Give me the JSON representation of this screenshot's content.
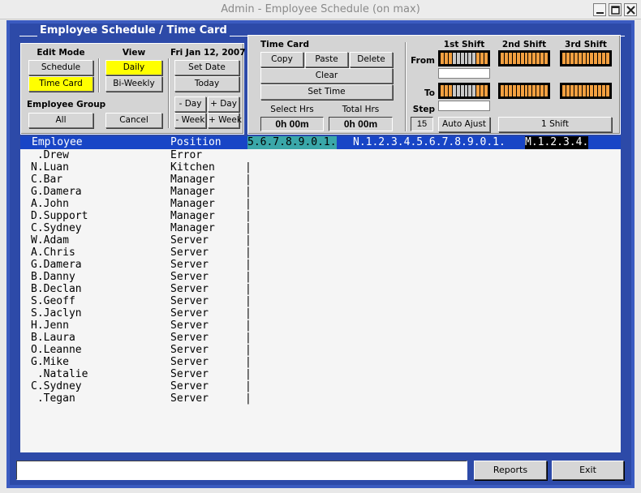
{
  "window": {
    "title": "Admin - Employee Schedule (on max)"
  },
  "group_title": "Employee Schedule / Time Card",
  "edit_mode": {
    "label": "Edit Mode",
    "schedule": "Schedule",
    "time_card": "Time Card"
  },
  "view": {
    "label": "View",
    "daily": "Daily",
    "biweekly": "Bi-Weekly"
  },
  "employee_group": {
    "label": "Employee Group",
    "all": "All",
    "cancel": "Cancel"
  },
  "date": {
    "label": "Fri Jan 12, 2007",
    "set_date": "Set Date",
    "today": "Today",
    "minus_day": "- Day",
    "plus_day": "+ Day",
    "minus_week": "- Week",
    "plus_week": "+ Week"
  },
  "time_card": {
    "label": "Time Card",
    "copy": "Copy",
    "paste": "Paste",
    "delete": "Delete",
    "clear": "Clear",
    "set_time": "Set Time",
    "select_hrs_label": "Select Hrs",
    "select_hrs_value": "0h 00m",
    "total_hrs_label": "Total Hrs",
    "total_hrs_value": "0h 00m"
  },
  "shifts": {
    "first": "1st Shift",
    "second": "2nd Shift",
    "third": "3rd Shift",
    "from": "From",
    "to": "To",
    "step_label": "Step",
    "step_value": "15",
    "auto_adjust": "Auto Ajust",
    "shift_count": "1 Shift"
  },
  "colors": {
    "frame": "#2d4aa8",
    "header": "#1845c6",
    "teal": "#3aa7a9",
    "highlight": "#ffff00",
    "swatch_orange": "#f3a040"
  },
  "header": {
    "employee": "Employee",
    "position": "Position",
    "hours_teal": "5.6.7.8.9.0.1.",
    "hours_blue": "N.1.2.3.4.5.6.7.8.9.0.1.",
    "hours_black": "M.1.2.3.4."
  },
  "employees": [
    {
      "name": " .Drew",
      "position": "Error",
      "mark": ""
    },
    {
      "name": "N.Luan",
      "position": "Kitchen",
      "mark": "|"
    },
    {
      "name": "C.Bar",
      "position": "Manager",
      "mark": "|"
    },
    {
      "name": "G.Damera",
      "position": "Manager",
      "mark": "|"
    },
    {
      "name": "A.John",
      "position": "Manager",
      "mark": "|"
    },
    {
      "name": "D.Support",
      "position": "Manager",
      "mark": "|"
    },
    {
      "name": "C.Sydney",
      "position": "Manager",
      "mark": "|"
    },
    {
      "name": "W.Adam",
      "position": "Server",
      "mark": "|"
    },
    {
      "name": "A.Chris",
      "position": "Server",
      "mark": "|"
    },
    {
      "name": "G.Damera",
      "position": "Server",
      "mark": "|"
    },
    {
      "name": "B.Danny",
      "position": "Server",
      "mark": "|"
    },
    {
      "name": "B.Declan",
      "position": "Server",
      "mark": "|"
    },
    {
      "name": "S.Geoff",
      "position": "Server",
      "mark": "|"
    },
    {
      "name": "S.Jaclyn",
      "position": "Server",
      "mark": "|"
    },
    {
      "name": "H.Jenn",
      "position": "Server",
      "mark": "|"
    },
    {
      "name": "B.Laura",
      "position": "Server",
      "mark": "|"
    },
    {
      "name": "O.Leanne",
      "position": "Server",
      "mark": "|"
    },
    {
      "name": "G.Mike",
      "position": "Server",
      "mark": "|"
    },
    {
      "name": " .Natalie",
      "position": "Server",
      "mark": "|"
    },
    {
      "name": "C.Sydney",
      "position": "Server",
      "mark": "|"
    },
    {
      "name": " .Tegan",
      "position": "Server",
      "mark": "|"
    }
  ],
  "footer": {
    "reports": "Reports",
    "exit": "Exit"
  }
}
